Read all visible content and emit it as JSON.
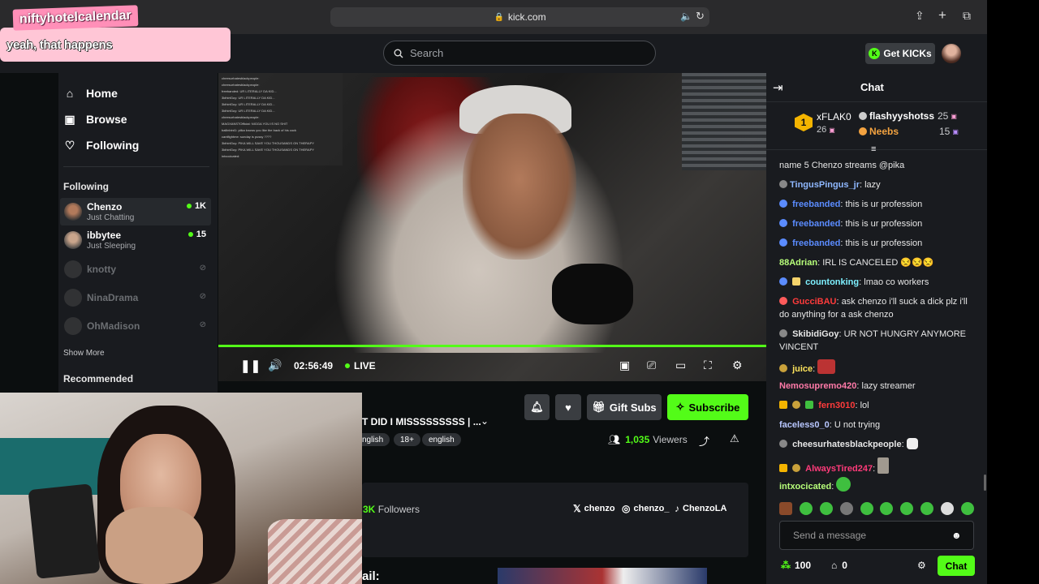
{
  "browser": {
    "url": "kick.com",
    "icons": [
      "sidebar-icon",
      "lock-icon",
      "mute-icon",
      "reload-icon",
      "share-icon",
      "new-tab-icon",
      "tabs-icon"
    ]
  },
  "header": {
    "search_placeholder": "Search",
    "get_kicks_label": "Get KICKs"
  },
  "sidebar": {
    "nav": [
      {
        "label": "Home",
        "icon": "home-icon"
      },
      {
        "label": "Browse",
        "icon": "browse-icon"
      },
      {
        "label": "Following",
        "icon": "heart-icon"
      }
    ],
    "following_title": "Following",
    "following": [
      {
        "name": "Chenzo",
        "category": "Just Chatting",
        "viewers": "1K",
        "live": true
      },
      {
        "name": "ibbytee",
        "category": "Just Sleeping",
        "viewers": "15",
        "live": true
      },
      {
        "name": "knotty",
        "live": false
      },
      {
        "name": "NinaDrama",
        "live": false
      },
      {
        "name": "OhMadison",
        "live": false
      }
    ],
    "show_more": "Show More",
    "recommended_title": "Recommended"
  },
  "player": {
    "time": "02:56:49",
    "live_label": "LIVE",
    "progress_fraction": 1.0,
    "overlay_chat": [
      "cheesurhatesblackpeople:",
      "cheesurhatesblackpeople:",
      "freebanded: UR LITERALLY DA KID...",
      "3kthirtGuy: UR LITERALLY DA KID...",
      "3kthirtGuy: UR LITERALLY DA KID...",
      "3kthirtGuy: UR LITERALLY DA KID...",
      "cheesurhatesblackpeople:",
      "MAGXANSTOfficial: NIGGA YOU IS NO SHIT",
      "ballinbird1: piika knows you like the back of his cock",
      "cantfightme: sunday is pussy ????",
      "3kthirtGuy: PIKA WILL SAVE YOU THOUSANDS ON THERAPY",
      "3kthirtGuy: PIKA WILL SAVE YOU THOUSANDS ON THERAPY",
      "intxocicated:"
    ]
  },
  "stream_info": {
    "title_fragment": "T DID I MISSSSSSSSS | ...",
    "tags": [
      "nglish",
      "18+",
      "english"
    ],
    "viewers_count": "1,035",
    "viewers_label": "Viewers",
    "followers_count": "3K",
    "followers_label": "Followers",
    "socials": [
      {
        "icon": "x-icon",
        "handle": "chenzo"
      },
      {
        "icon": "instagram-icon",
        "handle": "chenzo_"
      },
      {
        "icon": "tiktok-icon",
        "handle": "ChenzoLA"
      }
    ],
    "about_fragment": "ail:",
    "gift_subs_label": "Gift Subs",
    "subscribe_label": "Subscribe"
  },
  "chat": {
    "title": "Chat",
    "leaderboard": [
      {
        "rank": "1",
        "name": "xFLAK0",
        "count": "26"
      },
      {
        "name": "flashyyshotss",
        "count": "25"
      },
      {
        "name": "Neebs",
        "count": "15"
      }
    ],
    "messages": [
      {
        "user": "",
        "text": "name 5 Chenzo streams @pika",
        "color": "#e7e7e7"
      },
      {
        "user": "TingusPingus_jr",
        "text": "lazy",
        "color": "#8fb8ff"
      },
      {
        "user": "freebanded",
        "text": "this is ur profession",
        "color": "#5b8cff"
      },
      {
        "user": "freebanded",
        "text": "this is ur profession",
        "color": "#5b8cff"
      },
      {
        "user": "freebanded",
        "text": "this is ur profession",
        "color": "#5b8cff"
      },
      {
        "user": "88Adrian",
        "text": "IRL IS CANCELED 😒😒😒",
        "color": "#b7ff7a"
      },
      {
        "user": "countonking",
        "text": "lmao co workers",
        "color": "#7ef0ff"
      },
      {
        "user": "GucciBAU",
        "text": "ask chenzo i'll suck a dick plz i'll do anything for a ask chenzo",
        "color": "#ff3b3b"
      },
      {
        "user": "SkibidiGoy",
        "text": "UR NOT HUNGRY ANYMORE VINCENT",
        "color": "#e7e7e7"
      },
      {
        "user": "juice",
        "text": "",
        "color": "#ffe45c"
      },
      {
        "user": "Nemosupremo420",
        "text": "lazy streamer",
        "color": "#ff7aa8"
      },
      {
        "user": "fern3010",
        "text": "lol",
        "color": "#ff3b3b"
      },
      {
        "user": "faceless0_0",
        "text": "U not trying",
        "color": "#b8c7ff"
      },
      {
        "user": "cheesurhatesblackpeople",
        "text": "",
        "color": "#e7e7e7"
      },
      {
        "user": "AlwaysTired247",
        "text": "",
        "color": "#ff3b7a"
      },
      {
        "user": "intxocicated",
        "text": "",
        "color": "#b7ff7a"
      }
    ],
    "send_placeholder": "Send a message",
    "points": "100",
    "drops": "0",
    "chat_button_label": "Chat"
  },
  "overlay": {
    "sticker_name": "niftyhotelcalendar",
    "sticker_text": "yeah, that happens"
  },
  "colors": {
    "accent": "#53fc18",
    "bg": "#0b0e0f",
    "panel": "#191b1f"
  }
}
